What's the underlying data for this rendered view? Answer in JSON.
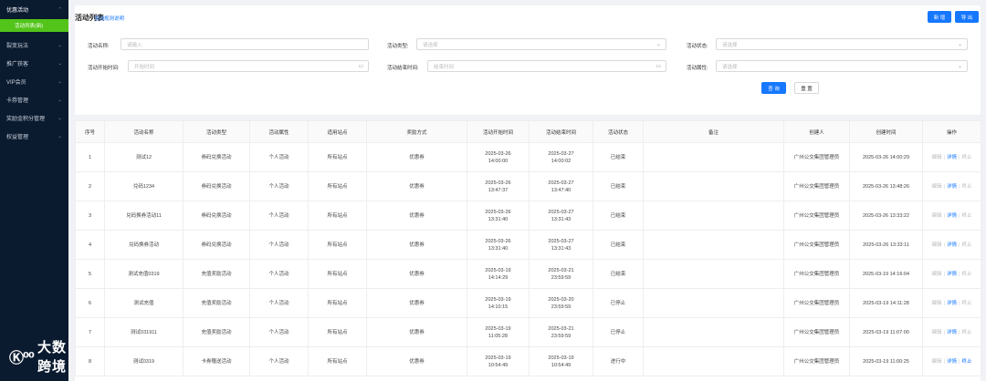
{
  "sidebar": {
    "groups": [
      {
        "label": "优惠活动",
        "open": true,
        "arrow": "⌃"
      },
      {
        "label": "裂变玩法",
        "arrow": "⌄"
      },
      {
        "label": "推广获客",
        "arrow": "⌄"
      },
      {
        "label": "VIP会员",
        "arrow": "⌄"
      },
      {
        "label": "卡券管理",
        "arrow": "⌄"
      },
      {
        "label": "奖励金积分管理",
        "arrow": "⌄"
      },
      {
        "label": "权益管理",
        "arrow": "⌄"
      }
    ],
    "active_sub": "活动列表(新)",
    "logo_mark": "Ⓚ⁰⁰",
    "logo_text": "大数跨境"
  },
  "header": {
    "title": "活动列表",
    "rules_link": "活动规则说明",
    "new_button": "新 增",
    "export_button": "导 出"
  },
  "filters": {
    "name_label": "活动名称:",
    "name_placeholder": "请输入",
    "type_label": "活动类型:",
    "type_placeholder": "请选择",
    "status_label": "活动状态:",
    "status_placeholder": "请选择",
    "start_label": "活动开始时间:",
    "start_placeholder": "开始时间",
    "end_label": "活动结束时间:",
    "end_placeholder": "结束时间",
    "attr_label": "活动属性:",
    "attr_placeholder": "请选择",
    "query_button": "查 询",
    "reset_button": "重 置"
  },
  "table": {
    "columns": [
      "序号",
      "活动名称",
      "活动类型",
      "活动属性",
      "适用站点",
      "奖励方式",
      "活动开始时间",
      "活动结束时间",
      "活动状态",
      "备注",
      "创建人",
      "创建时间",
      "操作"
    ],
    "rows": [
      {
        "no": "1",
        "name": "测试12",
        "type": "券码兑换活动",
        "attr": "个人活动",
        "site": "所有站点",
        "reward": "优惠券",
        "start_d": "2025-03-26",
        "start_t": "14:00:00",
        "end_d": "2025-03-27",
        "end_t": "14:00:02",
        "status": "已结束",
        "remark": "",
        "creator": "广州公交集团管理员",
        "created": "2025-03-26 14:00:29",
        "op1": "编辑",
        "op2": "详情",
        "op3": "终止",
        "op3_active": false
      },
      {
        "no": "2",
        "name": "兑码1234",
        "type": "券码兑换活动",
        "attr": "个人活动",
        "site": "所有站点",
        "reward": "优惠券",
        "start_d": "2025-03-26",
        "start_t": "13:47:37",
        "end_d": "2025-03-27",
        "end_t": "13:47:40",
        "status": "已结束",
        "remark": "",
        "creator": "广州公交集团管理员",
        "created": "2025-03-26 13:48:26",
        "op1": "编辑",
        "op2": "详情",
        "op3": "终止",
        "op3_active": false
      },
      {
        "no": "3",
        "name": "兑码换券活动11",
        "type": "券码兑换活动",
        "attr": "个人活动",
        "site": "所有站点",
        "reward": "优惠券",
        "start_d": "2025-03-26",
        "start_t": "13:31:40",
        "end_d": "2025-03-27",
        "end_t": "13:31:43",
        "status": "已结束",
        "remark": "",
        "creator": "广州公交集团管理员",
        "created": "2025-03-26 13:33:22",
        "op1": "编辑",
        "op2": "详情",
        "op3": "终止",
        "op3_active": false
      },
      {
        "no": "4",
        "name": "兑码换券活动",
        "type": "券码兑换活动",
        "attr": "个人活动",
        "site": "所有站点",
        "reward": "优惠券",
        "start_d": "2025-03-26",
        "start_t": "13:31:40",
        "end_d": "2025-03-27",
        "end_t": "13:31:43",
        "status": "已结束",
        "remark": "",
        "creator": "广州公交集团管理员",
        "created": "2025-03-26 13:33:11",
        "op1": "编辑",
        "op2": "详情",
        "op3": "终止",
        "op3_active": false
      },
      {
        "no": "5",
        "name": "测试充值0319",
        "type": "充值奖励活动",
        "attr": "个人活动",
        "site": "所有站点",
        "reward": "优惠券",
        "start_d": "2025-03-19",
        "start_t": "14:14:29",
        "end_d": "2025-03-21",
        "end_t": "23:59:59",
        "status": "已结束",
        "remark": "",
        "creator": "广州公交集团管理员",
        "created": "2025-03-19 14:16:04",
        "op1": "编辑",
        "op2": "详情",
        "op3": "终止",
        "op3_active": false
      },
      {
        "no": "6",
        "name": "测试充值",
        "type": "充值奖励活动",
        "attr": "个人活动",
        "site": "所有站点",
        "reward": "优惠券",
        "start_d": "2025-03-19",
        "start_t": "14:10:15",
        "end_d": "2025-03-20",
        "end_t": "23:59:59",
        "status": "已停止",
        "remark": "",
        "creator": "广州公交集团管理员",
        "created": "2025-03-19 14:11:28",
        "op1": "编辑",
        "op2": "详情",
        "op3": "终止",
        "op3_active": false
      },
      {
        "no": "7",
        "name": "测试031911",
        "type": "充值奖励活动",
        "attr": "个人活动",
        "site": "所有站点",
        "reward": "优惠券",
        "start_d": "2025-03-19",
        "start_t": "11:05:28",
        "end_d": "2025-03-21",
        "end_t": "23:59:59",
        "status": "已停止",
        "remark": "",
        "creator": "广州公交集团管理员",
        "created": "2025-03-19 11:07:00",
        "op1": "编辑",
        "op2": "详情",
        "op3": "终止",
        "op3_active": false
      },
      {
        "no": "8",
        "name": "测试0319",
        "type": "卡券赠送活动",
        "attr": "个人活动",
        "site": "所有站点",
        "reward": "优惠券",
        "start_d": "2025-03-19",
        "start_t": "10:54:49",
        "end_d": "2025-03-19",
        "end_t": "10:54:49",
        "status": "进行中",
        "remark": "",
        "creator": "广州公交集团管理员",
        "created": "2025-03-19 11:00:25",
        "op1": "编辑",
        "op2": "详情",
        "op3": "终止",
        "op3_active": true
      }
    ]
  },
  "colors": {
    "primary": "#1677ff",
    "sidebar_bg": "#0a1a2f",
    "active_menu": "#52c41a"
  }
}
